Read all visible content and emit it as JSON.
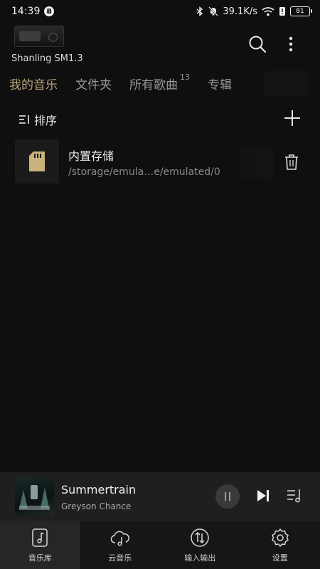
{
  "status_bar": {
    "time": "14:39",
    "app_badge": "Ƀ",
    "net_speed": "39.1K/s",
    "battery": "81"
  },
  "header": {
    "device_name": "Shanling SM1.3"
  },
  "tabs": [
    {
      "label": "我的音乐",
      "active": true
    },
    {
      "label": "文件夹",
      "active": false
    },
    {
      "label": "所有歌曲",
      "count": "13",
      "active": false
    },
    {
      "label": "专辑",
      "active": false
    }
  ],
  "sort": {
    "label": "排序"
  },
  "storage": {
    "title": "内置存储",
    "path": "/storage/emula…e/emulated/0"
  },
  "player": {
    "title": "Summertrain",
    "artist": "Greyson Chance"
  },
  "bottom_nav": [
    {
      "label": "音乐库",
      "icon": "music-note-icon",
      "active": true
    },
    {
      "label": "云音乐",
      "icon": "cloud-music-icon",
      "active": false
    },
    {
      "label": "输入输出",
      "icon": "input-output-icon",
      "active": false
    },
    {
      "label": "设置",
      "icon": "gear-icon",
      "active": false
    }
  ],
  "colors": {
    "background": "#0f0f0f",
    "accent": "#b9a67a",
    "sd_card": "#c9b27c"
  }
}
